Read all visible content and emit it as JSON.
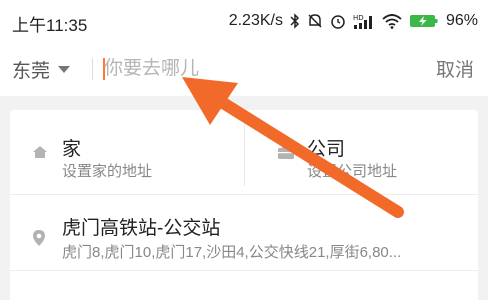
{
  "status_bar": {
    "time": "上午11:35",
    "network_speed": "2.23K/s",
    "battery_percent": "96%",
    "icons": [
      "bluetooth-icon",
      "mute-icon",
      "alarm-icon",
      "hd-signal-icon",
      "wifi-icon",
      "battery-charging-icon"
    ]
  },
  "search": {
    "city": "东莞",
    "placeholder": "你要去哪儿",
    "value": "",
    "cancel_label": "取消"
  },
  "shortcuts": {
    "home": {
      "title": "家",
      "subtitle": "设置家的地址",
      "icon": "home-icon"
    },
    "work": {
      "title": "公司",
      "subtitle": "设置公司地址",
      "icon": "briefcase-icon"
    }
  },
  "history": [
    {
      "title": "虎门高铁站-公交站",
      "subtitle": "虎门8,虎门10,虎门17,沙田4,公交快线21,厚街6,80...",
      "icon": "location-pin-icon"
    }
  ],
  "annotation": {
    "color": "#f26a2a",
    "icon": "arrow-annotation"
  },
  "colors": {
    "accent": "#ff7a2e",
    "background": "#f2f2f2"
  }
}
